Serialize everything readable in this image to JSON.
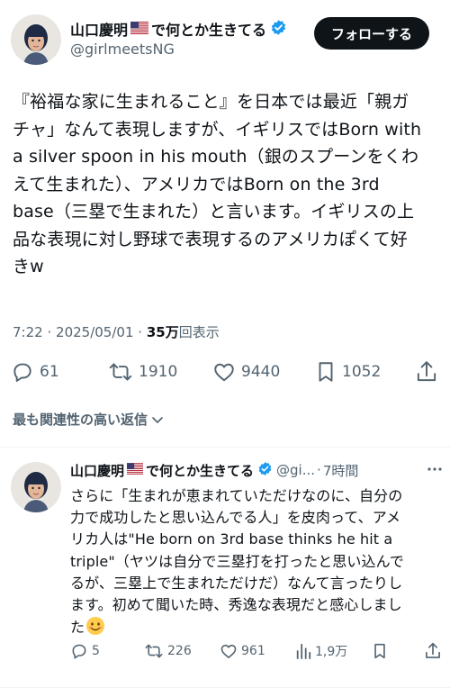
{
  "author": {
    "display_name": "山口慶明",
    "flag": "🇺🇸",
    "name_suffix": "で何とか生きてる",
    "handle": "@girlmeetsNG"
  },
  "follow_button": {
    "label": "フォローする"
  },
  "tweet": {
    "text_lines": [
      "『裕福な家に生まれること』を日本では最近「親ガ",
      "チャ」なんて表現しますが、イギリスではBorn with",
      "a silver spoon in his mouth（銀のスプーンをくわ",
      "えて生まれた）、アメリカではBorn on the 3rd",
      "base（三塁で生まれた）と言います。イギリスの上",
      "品な表現に対し野球で表現するのアメリカぽくて好",
      "きw"
    ],
    "time": "7:22",
    "separator": "·",
    "date": "2025/05/01",
    "views_count": "35万",
    "views_label": "回表示",
    "stats": {
      "replies": "61",
      "retweets": "1910",
      "likes": "9440",
      "bookmarks": "1052"
    }
  },
  "sort": {
    "label": "最も関連性の高い返信"
  },
  "reply": {
    "author_display_name": "山口慶明",
    "author_flag": "🇺🇸",
    "author_name_suffix": "で何とか生きてる",
    "author_handle_truncated": "@gi...",
    "separator": "·",
    "time_ago": "7時間",
    "text_lines": [
      "さらに「生まれが恵まれていただけなのに、自分の",
      "力で成功したと思い込んでる人」を皮肉って、アメ",
      "リカ人は\"He born on 3rd base thinks he hit a",
      "triple\"（ヤツは自分で三塁打を打ったと思い込んで",
      "るが、三塁上で生まれただけだ）なんて言ったりし",
      "ます。初めて聞いた時、秀逸な表現だと感心しまし",
      "た"
    ],
    "emoji": "😊",
    "stats": {
      "replies": "5",
      "retweets": "226",
      "likes": "961",
      "views": "1,9万"
    }
  },
  "colors": {
    "text": "#0f1419",
    "secondary": "#536471",
    "verified": "#1d9bf0",
    "button_bg": "#0f1419",
    "avatar_bg": "#e8e4de"
  },
  "icons": {
    "reply": "reply-icon",
    "retweet": "retweet-icon",
    "like": "heart-icon",
    "bookmark": "bookmark-icon",
    "share": "share-icon",
    "views": "views-icon",
    "more": "more-icon",
    "verified": "verified-badge-icon",
    "chevron": "chevron-down-icon"
  }
}
